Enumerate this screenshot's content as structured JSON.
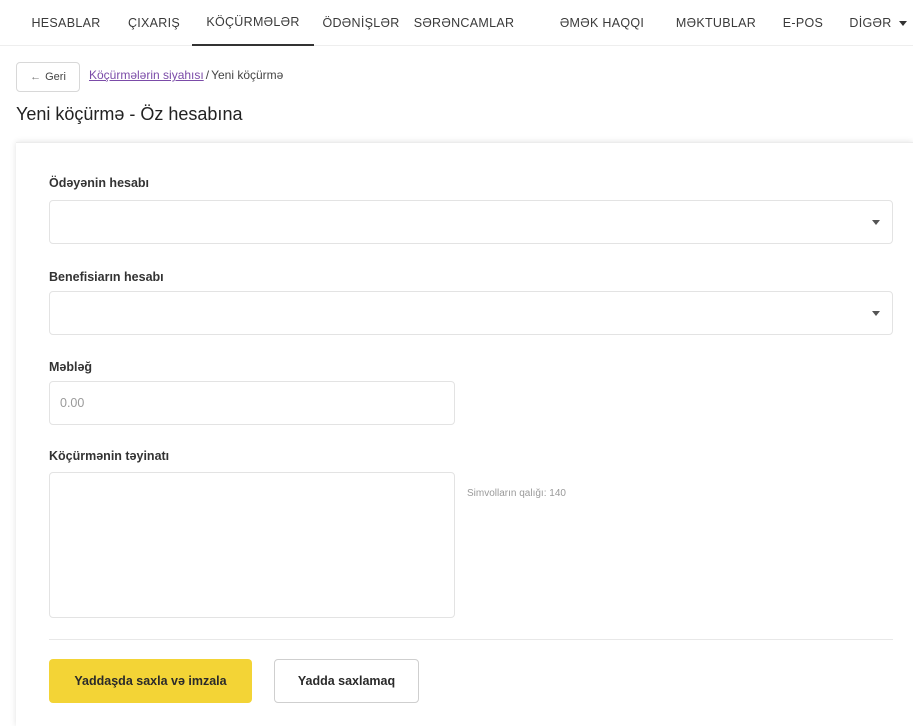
{
  "nav": {
    "tabs": [
      {
        "label": "HESABLAR"
      },
      {
        "label": "ÇIXARIŞ"
      },
      {
        "label": "KÖÇÜRMƏLƏR"
      },
      {
        "label": "ÖDƏNİŞLƏR"
      },
      {
        "label": "SƏRƏNCAMLAR"
      },
      {
        "label": "ƏMƏK HAQQI"
      },
      {
        "label": "MƏKTUBLAR"
      },
      {
        "label": "E-POS"
      },
      {
        "label": "DİGƏR"
      }
    ],
    "active_tab": "KÖÇÜRMƏLƏR"
  },
  "breadcrumb": {
    "back_label": "Geri",
    "back_arrow": "←",
    "link_label": "Köçürmələrin siyahısı",
    "separator": "/",
    "current": "Yeni köçürmə"
  },
  "page_title": "Yeni köçürmə - Öz hesabına",
  "form": {
    "payer_account": {
      "label": "Ödəyənin hesabı",
      "value": ""
    },
    "beneficiary_account": {
      "label": "Benefisiarın hesabı",
      "value": ""
    },
    "amount": {
      "label": "Məbləğ",
      "placeholder": "0.00",
      "value": ""
    },
    "purpose": {
      "label": "Köçürmənin təyinatı",
      "value": "",
      "chars_left_text": "Simvolların qalığı: 140"
    }
  },
  "buttons": {
    "save_and_sign": "Yaddaşda saxla və imzala",
    "save": "Yadda saxlamaq"
  },
  "colors": {
    "primary_button": "#f3d436",
    "link": "#7b4ba8"
  }
}
